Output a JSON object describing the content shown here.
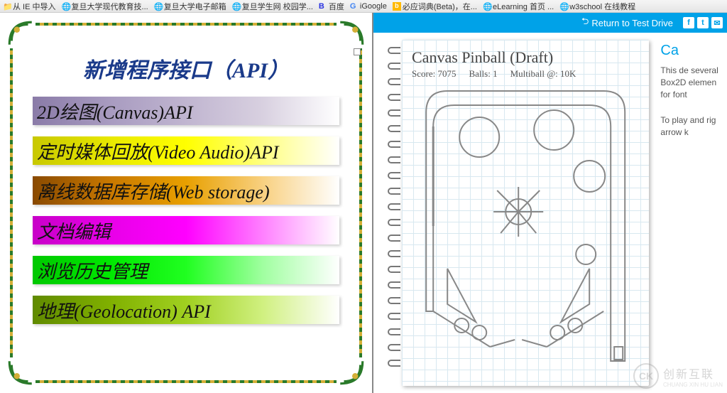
{
  "bookmarks": [
    {
      "label": "从 IE 中导入",
      "icon": "folder"
    },
    {
      "label": "复旦大学现代教育技...",
      "icon": "globe-green"
    },
    {
      "label": "复旦大学电子邮箱",
      "icon": "globe-green"
    },
    {
      "label": "复旦学生网 校园学...",
      "icon": "globe-blue"
    },
    {
      "label": "百度",
      "icon": "baidu"
    },
    {
      "label": "iGoogle",
      "icon": "google"
    },
    {
      "label": "必应词典(Beta)，在...",
      "icon": "bing"
    },
    {
      "label": "eLearning  首页 ...",
      "icon": "globe-green"
    },
    {
      "label": "w3school 在线教程",
      "icon": "globe-green"
    }
  ],
  "slide": {
    "title": "新增程序接口（API）",
    "items": [
      "2D绘图(Canvas)API",
      "定时媒体回放(Video Audio)API",
      "离线数据库存储(Web storage)",
      "文档编辑",
      "浏览历史管理",
      "地理(Geolocation) API"
    ]
  },
  "testdrive": {
    "return_label": "Return to Test Drive",
    "game_title": "Canvas Pinball (Draft)",
    "score_label": "Score:",
    "score_value": "7075",
    "balls_label": "Balls:",
    "balls_value": "1",
    "multiball_label": "Multiball @:",
    "multiball_value": "10K",
    "side_title": "Ca",
    "side_p1": "This de several Box2D elemen for font",
    "side_p2": "To play and rig arrow k"
  },
  "watermark": {
    "logo": "CK",
    "text": "创新互联",
    "sub": "CHUANG XIN HU LIAN"
  }
}
